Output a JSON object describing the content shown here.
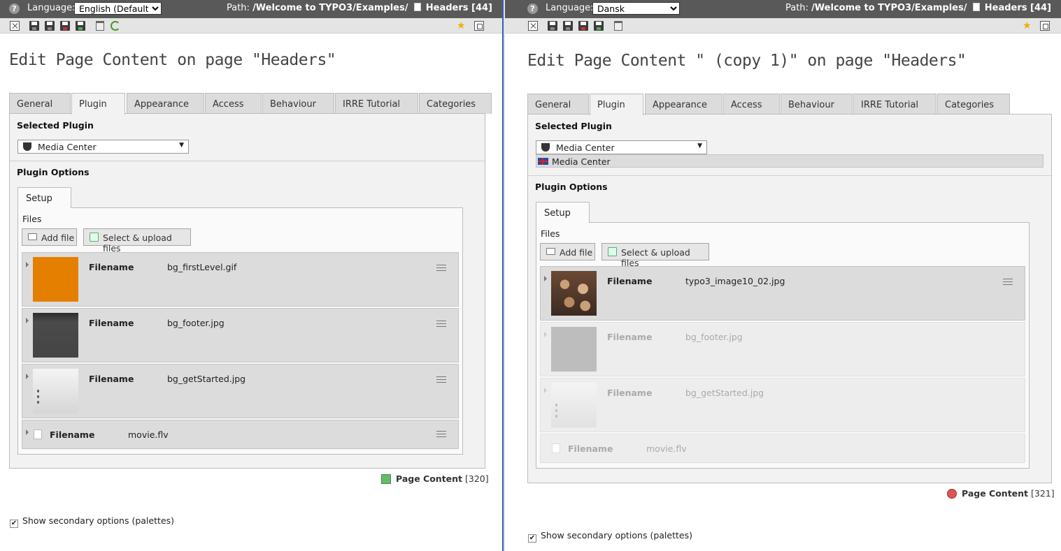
{
  "left": {
    "language_label": "Language:",
    "language_value": "English (Default)",
    "path_label": "Path:",
    "path_value": "/Welcome to TYPO3/Examples/",
    "path_page": "Headers [44]",
    "title": "Edit Page Content on page \"Headers\"",
    "tabs": [
      "General",
      "Plugin",
      "Appearance",
      "Access",
      "Behaviour",
      "IRRE Tutorial",
      "Categories"
    ],
    "active_tab": "Plugin",
    "selected_plugin_label": "Selected Plugin",
    "plugin_value": "Media Center",
    "plugin_options_label": "Plugin Options",
    "setup_tab": "Setup",
    "files_label": "Files",
    "add_file": "Add file",
    "select_upload": "Select & upload files",
    "files": [
      {
        "label": "Filename",
        "name": "bg_firstLevel.gif"
      },
      {
        "label": "Filename",
        "name": "bg_footer.jpg"
      },
      {
        "label": "Filename",
        "name": "bg_getStarted.jpg"
      },
      {
        "label": "Filename",
        "name": "movie.flv"
      }
    ],
    "record_label": "Page Content",
    "record_id": "[320]",
    "secondary_options": "Show secondary options (palettes)"
  },
  "right": {
    "language_label": "Language:",
    "language_value": "Dansk",
    "path_label": "Path:",
    "path_value": "/Welcome to TYPO3/Examples/",
    "path_page": "Headers [44]",
    "title": "Edit Page Content \" (copy 1)\" on page \"Headers\"",
    "tabs": [
      "General",
      "Plugin",
      "Appearance",
      "Access",
      "Behaviour",
      "IRRE Tutorial",
      "Categories"
    ],
    "active_tab": "Plugin",
    "selected_plugin_label": "Selected Plugin",
    "plugin_value": "Media Center",
    "default_lang_value": "Media Center",
    "plugin_options_label": "Plugin Options",
    "setup_tab": "Setup",
    "files_label": "Files",
    "add_file": "Add file",
    "select_upload": "Select & upload files",
    "files": [
      {
        "label": "Filename",
        "name": "typo3_image10_02.jpg"
      },
      {
        "label": "Filename",
        "name": "bg_footer.jpg"
      },
      {
        "label": "Filename",
        "name": "bg_getStarted.jpg"
      },
      {
        "label": "Filename",
        "name": "movie.flv"
      }
    ],
    "record_label": "Page Content",
    "record_id": "[321]",
    "secondary_options": "Show secondary options (palettes)"
  },
  "icons": {
    "help": "help-icon",
    "close": "close-icon",
    "save": "save-icon",
    "save_view": "save-and-view-icon",
    "save_close": "save-and-close-icon",
    "save_new": "save-and-new-icon",
    "delete": "trash-icon",
    "undo": "undo-icon",
    "bookmark": "shortcut-star-icon",
    "fullscreen": "open-in-new-window-icon"
  },
  "colors": {
    "topbar": "#595959",
    "toolbar": "#e4e4e4",
    "panel": "#f2f2f2",
    "row": "#dcdcdc",
    "splitter": "#3a62a8",
    "thumb_orange": "#e57f00",
    "thumb_dark": "#454545"
  }
}
